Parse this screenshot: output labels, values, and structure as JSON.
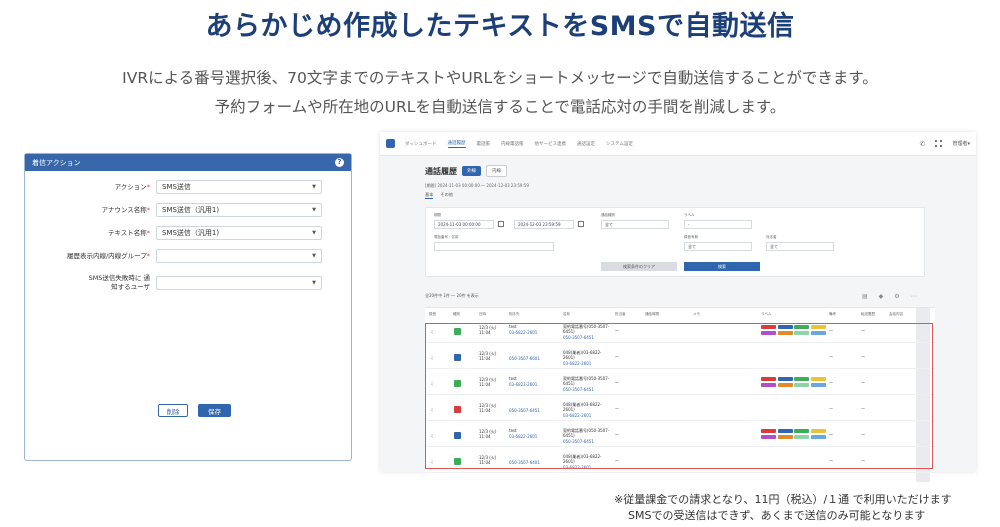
{
  "headline": "あらかじめ作成したテキストをSMSで自動送信",
  "sub_lines": [
    "IVRによる番号選択後、70文字までのテキストやURLをショートメッセージで自動送信することができます。",
    "予約フォームや所在地のURLを自動送信することで電話応対の手間を削減します。"
  ],
  "action_panel": {
    "title": "着信アクション",
    "help_icon": "?",
    "fields": [
      {
        "label": "アクション",
        "required": true,
        "value": "SMS送信"
      },
      {
        "label": "アナウンス名称",
        "required": true,
        "value": "SMS送信（汎用1)"
      },
      {
        "label": "テキスト名称",
        "required": true,
        "value": "SMS送信（汎用1)"
      },
      {
        "label": "履歴表示内線/内線グループ",
        "required": true,
        "value": ""
      },
      {
        "label": "SMS送信失敗時に 通知するユーザ",
        "required": false,
        "value": ""
      }
    ],
    "required_mark": "*",
    "delete_label": "削除",
    "save_label": "保存"
  },
  "screenshot": {
    "nav": [
      "ダッシュボード",
      "通話履歴",
      "電話帳",
      "内線電話帳",
      "他サービス連携",
      "通話設定",
      "システム設定"
    ],
    "user_label": "管理者▾",
    "page_title": "通話履歴",
    "tab_active": "外線",
    "tab_inactive": "内線",
    "period": "[期間] 2024-11-03 00:00:00 〜 2024-12-03 23:59:59",
    "subtabs": [
      "基本",
      "その他"
    ],
    "filter": {
      "period_label": "期間",
      "from": "2024-11-03 00:00:00",
      "to": "2024-12-03 23:59:59",
      "select1_label": "通話種別",
      "select1_value": "全て",
      "select2_label": "ラベル",
      "select2_value": "-",
      "search_label": "電話番号・名前",
      "select3_label": "録音有無",
      "select3_value": "全て",
      "select4_label": "対応者",
      "select4_value": "全て",
      "clear_label": "検索条件のクリア",
      "search_button": "検索"
    },
    "pager_text": "全20件中 1件 〜 20件 を表示",
    "headers": [
      "録音",
      "種別",
      "日時",
      "相手先",
      "名前",
      "担当者",
      "通話時間",
      "メモ",
      "ラベル",
      "備考",
      "転送履歴",
      "会話内容"
    ],
    "rows": [
      {
        "date": "12/3 (火) 11:04",
        "caller": "test",
        "number": "03-6822-2601",
        "name": "契約電話番号(050-3507-6451)",
        "num2": "050-3507-6451",
        "status_color": "#3cae5a"
      },
      {
        "date": "12/3 (火) 11:04",
        "caller": "",
        "number": "050-3507-6601",
        "name": "048(業者)(03-6822-2601)",
        "num2": "03-6822-2601",
        "status_color": "#2f66ad"
      },
      {
        "date": "12/3 (火) 11:04",
        "caller": "test",
        "number": "03-6822-2601",
        "name": "契約電話番号(050-3507-6451)",
        "num2": "050-3507-6451",
        "status_color": "#3cae5a"
      },
      {
        "date": "12/3 (火) 11:04",
        "caller": "",
        "number": "050-3507-6451",
        "name": "048(業者)(03-6822-2601)",
        "num2": "03-6822-2601",
        "status_color": "#d93b3b"
      },
      {
        "date": "12/3 (火) 11:04",
        "caller": "test",
        "number": "03-6822-2601",
        "name": "契約電話番号(050-3507-6451)",
        "num2": "050-3507-6451",
        "status_color": "#2f66ad"
      },
      {
        "date": "12/3 (火) 11:04",
        "caller": "",
        "number": "050-3507-6401",
        "name": "048(業者)(03-6822-2601)",
        "num2": "03-6822-2601",
        "status_color": "#3cae5a"
      }
    ]
  },
  "footnotes": [
    "※従量課金での請求となり、11円（税込）/１通 で利用いただけます",
    "SMSでの受送信はできず、あくまで送信のみ可能となります"
  ],
  "colors": {
    "brand": "#1d3f78",
    "panel_header": "#3767a8",
    "highlight": "#e25555"
  }
}
